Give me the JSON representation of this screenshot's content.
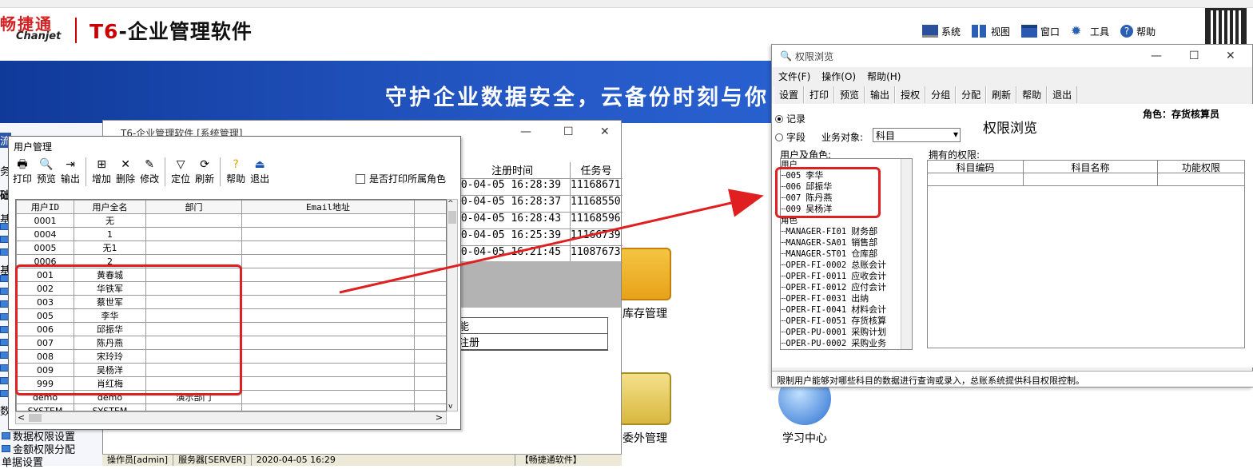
{
  "brand": {
    "cn": "畅捷通",
    "en": "Chanjet",
    "product_prefix": "T6",
    "product": "-企业管理软件"
  },
  "topmenu": [
    {
      "label": "系统",
      "icon": "monitor-icon"
    },
    {
      "label": "视图",
      "icon": "grid-icon"
    },
    {
      "label": "窗口",
      "icon": "window-icon"
    },
    {
      "label": "工具",
      "icon": "gear-icon"
    },
    {
      "label": "帮助",
      "icon": "help-icon"
    }
  ],
  "banner": {
    "text": "守护企业数据安全，云备份时刻与你"
  },
  "left_tree": [
    {
      "label": "流"
    },
    {
      "label": "务"
    },
    {
      "label": "础"
    },
    {
      "label": "基"
    },
    {
      "label": "基"
    },
    {
      "label": "数"
    },
    {
      "label": "数据权限设置"
    },
    {
      "label": "金额权限分配"
    },
    {
      "label": "单据设置"
    }
  ],
  "desktop": {
    "icons": [
      {
        "label": "库存管理"
      },
      {
        "label": "委外管理"
      },
      {
        "label": "学习中心"
      }
    ]
  },
  "statusbar": {
    "operator": "操作员[admin]",
    "server": "服务器[SERVER]",
    "datetime": "2020-04-05 16:29",
    "brand": "【畅捷通软件】"
  },
  "syswin": {
    "title": "T6-企业管理软件 [系统管理]",
    "headers": [
      "注册时间",
      "任务号"
    ],
    "rows": [
      [
        "20-04-05 16:28:39",
        "11168671"
      ],
      [
        "20-04-05 16:28:37",
        "11168550"
      ],
      [
        "20-04-05 16:28:43",
        "11168596"
      ],
      [
        "20-04-05 16:25:39",
        "11166739"
      ],
      [
        "20-04-05 16:21:45",
        "11087673"
      ]
    ],
    "list": [
      "能",
      "注册"
    ]
  },
  "userwin": {
    "title": "用户管理",
    "toolbar": [
      {
        "label": "打印",
        "icon": "print-icon"
      },
      {
        "label": "预览",
        "icon": "preview-icon"
      },
      {
        "label": "输出",
        "icon": "export-icon"
      },
      {
        "label": "增加",
        "icon": "add-icon"
      },
      {
        "label": "删除",
        "icon": "delete-icon"
      },
      {
        "label": "修改",
        "icon": "edit-icon"
      },
      {
        "label": "定位",
        "icon": "filter-icon"
      },
      {
        "label": "刷新",
        "icon": "refresh-icon"
      },
      {
        "label": "帮助",
        "icon": "help-icon"
      },
      {
        "label": "退出",
        "icon": "exit-icon"
      }
    ],
    "print_roles_label": "是否打印所属角色",
    "columns": [
      "用户ID",
      "用户全名",
      "部门",
      "Email地址"
    ],
    "rows": [
      [
        "0001",
        "无",
        "",
        ""
      ],
      [
        "0004",
        "1",
        "",
        ""
      ],
      [
        "0005",
        "无1",
        "",
        ""
      ],
      [
        "0006",
        "2",
        "",
        ""
      ],
      [
        "001",
        "黄春城",
        "",
        ""
      ],
      [
        "002",
        "华铁军",
        "",
        ""
      ],
      [
        "003",
        "蔡世军",
        "",
        ""
      ],
      [
        "005",
        "李华",
        "",
        ""
      ],
      [
        "006",
        "邱振华",
        "",
        ""
      ],
      [
        "007",
        "陈丹燕",
        "",
        ""
      ],
      [
        "008",
        "宋玲玲",
        "",
        ""
      ],
      [
        "009",
        "吴杨洋",
        "",
        ""
      ],
      [
        "999",
        "肖红梅",
        "",
        ""
      ],
      [
        "demo",
        "demo",
        "演示部门",
        ""
      ],
      [
        "SYSTEM",
        "SYSTEM",
        "",
        ""
      ]
    ]
  },
  "permwin": {
    "title": "权限浏览",
    "menu": [
      "文件(F)",
      "操作(O)",
      "帮助(H)"
    ],
    "toolbar": [
      "设置",
      "打印",
      "预览",
      "输出",
      "授权",
      "分组",
      "分配",
      "刷新",
      "帮助",
      "退出"
    ],
    "radio_record": "记录",
    "radio_field": "字段",
    "business_object_label": "业务对象:",
    "business_object": "科目",
    "heading": "权限浏览",
    "role": "角色：存货核算员",
    "users_roles_label": "用户及角色:",
    "owned_label": "拥有的权限:",
    "users_group": "用户",
    "users": [
      {
        "id": "005",
        "name": "李华"
      },
      {
        "id": "006",
        "name": "邱振华"
      },
      {
        "id": "007",
        "name": "陈丹燕"
      },
      {
        "id": "009",
        "name": "吴杨洋"
      }
    ],
    "roles_group": "角色",
    "roles": [
      {
        "id": "MANAGER-FI01",
        "name": "财务部"
      },
      {
        "id": "MANAGER-SA01",
        "name": "销售部"
      },
      {
        "id": "MANAGER-ST01",
        "name": "仓库部"
      },
      {
        "id": "OPER-FI-0002",
        "name": "总账会计"
      },
      {
        "id": "OPER-FI-0011",
        "name": "应收会计"
      },
      {
        "id": "OPER-FI-0012",
        "name": "应付会计"
      },
      {
        "id": "OPER-FI-0031",
        "name": "出纳"
      },
      {
        "id": "OPER-FI-0041",
        "name": "材料会计"
      },
      {
        "id": "OPER-FI-0051",
        "name": "存货核算"
      },
      {
        "id": "OPER-PU-0001",
        "name": "采购计划"
      },
      {
        "id": "OPER-PU-0002",
        "name": "采购业务"
      }
    ],
    "columns": [
      "科目编码",
      "科目名称",
      "功能权限"
    ],
    "status": "限制用户能够对哪些科目的数据进行查询或录入，总账系统提供科目权限控制。"
  },
  "colors": {
    "annotation": "#e02020",
    "banner": "#2457c4",
    "brand_red": "#d42020"
  }
}
